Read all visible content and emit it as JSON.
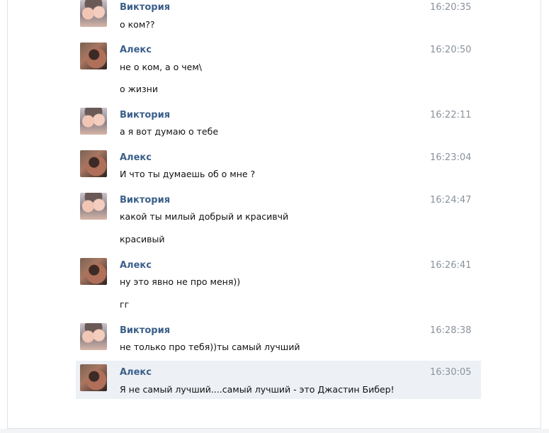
{
  "messages": [
    {
      "author": "Виктория",
      "time": "16:20:35",
      "avatar": "viktoria-avatar",
      "lines": [
        "о ком??"
      ]
    },
    {
      "author": "Алекс",
      "time": "16:20:50",
      "avatar": "aleks-avatar",
      "lines": [
        "не о ком, а о чем\\",
        "о жизни"
      ]
    },
    {
      "author": "Виктория",
      "time": "16:22:11",
      "avatar": "viktoria-avatar",
      "lines": [
        "а я вот думаю о тебе"
      ]
    },
    {
      "author": "Алекс",
      "time": "16:23:04",
      "avatar": "aleks-avatar",
      "lines": [
        "И что ты думаешь об о мне ?"
      ]
    },
    {
      "author": "Виктория",
      "time": "16:24:47",
      "avatar": "viktoria-avatar",
      "lines": [
        "какой ты милый добрый и красивчй",
        "красивый"
      ]
    },
    {
      "author": "Алекс",
      "time": "16:26:41",
      "avatar": "aleks-avatar",
      "lines": [
        "ну это явно не про меня))",
        "гг"
      ]
    },
    {
      "author": "Виктория",
      "time": "16:28:38",
      "avatar": "viktoria-avatar",
      "lines": [
        "не только про тебя))ты самый лучший"
      ]
    },
    {
      "author": "Алекс",
      "time": "16:30:05",
      "avatar": "aleks-avatar",
      "lines": [
        "Я не самый лучший....самый лучший - это Джастин Бибер!"
      ]
    }
  ]
}
